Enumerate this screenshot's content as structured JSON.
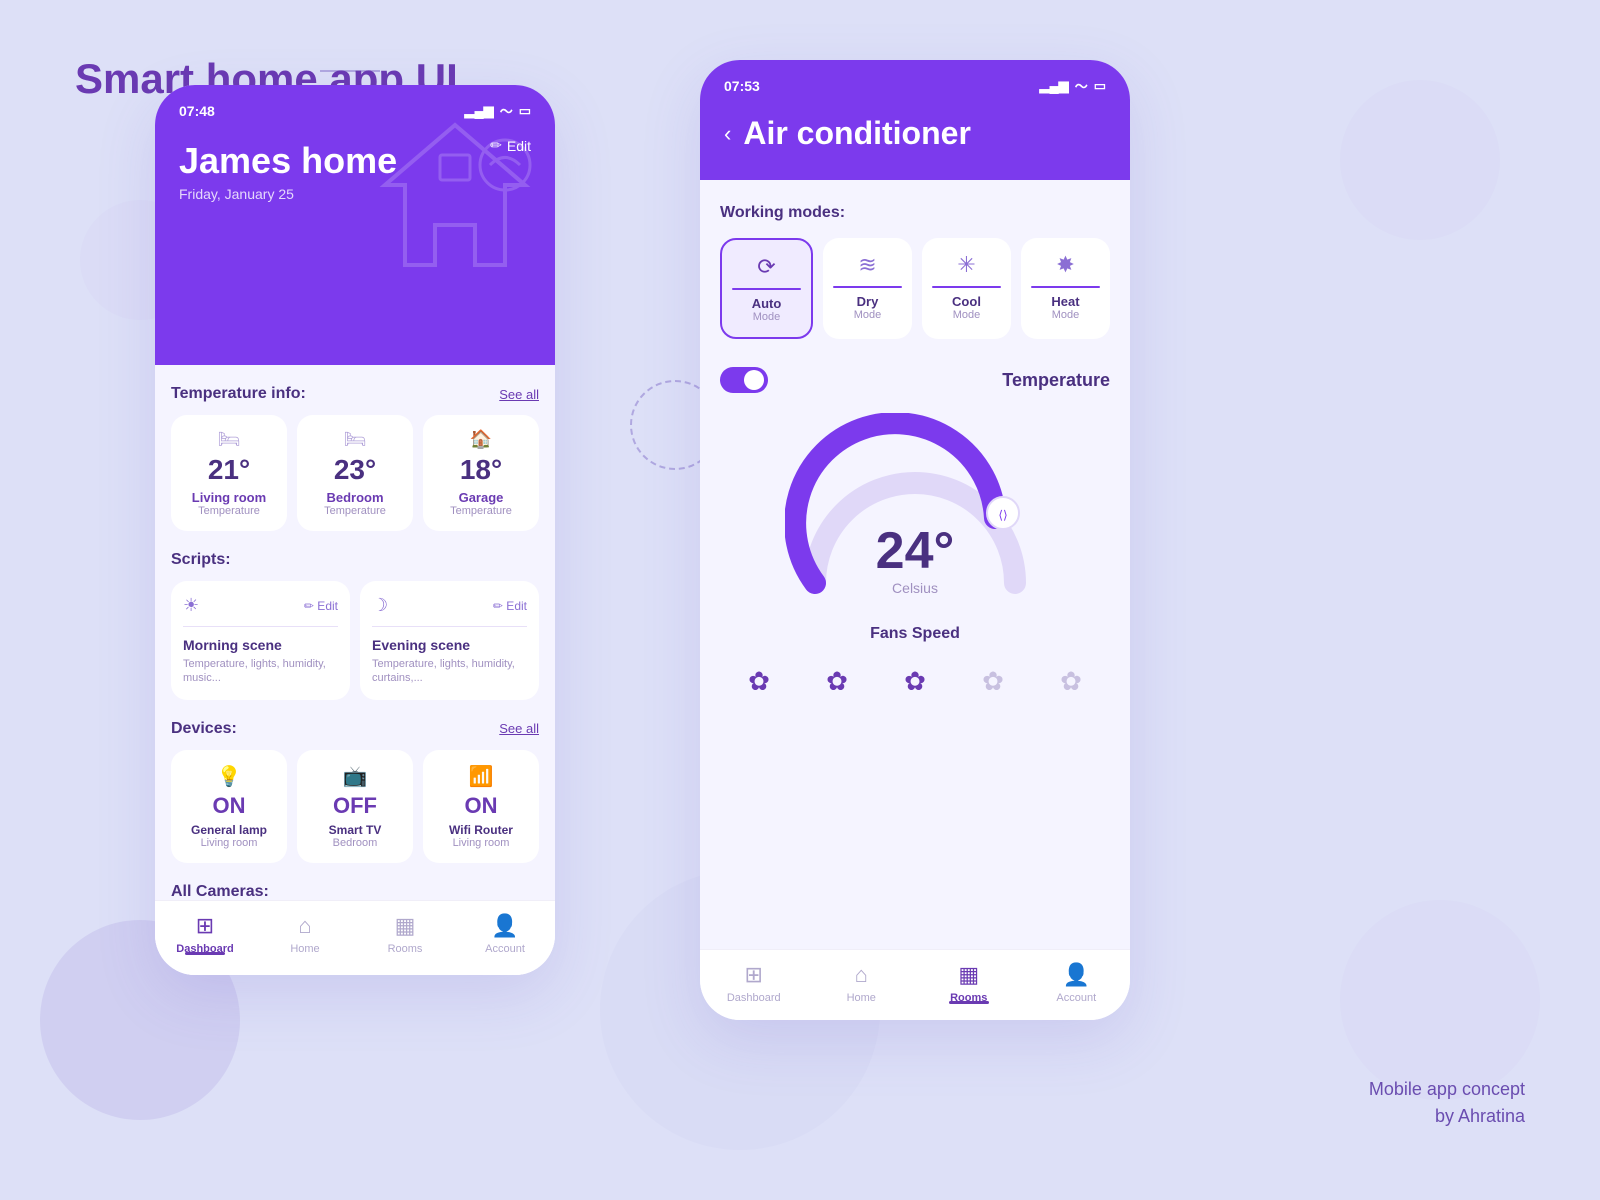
{
  "page": {
    "title": "Smart home app UI",
    "credit_line1": "Mobile app concept",
    "credit_line2": "by Ahratina",
    "bg_color": "#dde0f7"
  },
  "phone1": {
    "status_time": "07:48",
    "home_name": "James home",
    "home_date": "Friday, January 25",
    "edit_label": "Edit",
    "temperature_section": "Temperature info:",
    "see_all_temp": "See all",
    "temps": [
      {
        "value": "21°",
        "room": "Living room",
        "label": "Temperature"
      },
      {
        "value": "23°",
        "room": "Bedroom",
        "label": "Temperature"
      },
      {
        "value": "18°",
        "room": "Garage",
        "label": "Temperature"
      }
    ],
    "scripts_section": "Scripts:",
    "scripts": [
      {
        "icon": "☀",
        "edit": "✏ Edit",
        "name": "Morning scene",
        "desc": "Temperature, lights, humidity, music..."
      },
      {
        "icon": "☽",
        "edit": "✏ Edit",
        "name": "Evening scene",
        "desc": "Temperature, lights, humidity, curtains,..."
      }
    ],
    "devices_section": "Devices:",
    "see_all_devices": "See all",
    "devices": [
      {
        "icon": "💡",
        "status": "ON",
        "name": "General lamp",
        "location": "Living room"
      },
      {
        "icon": "📺",
        "status": "OFF",
        "name": "Smart TV",
        "location": "Bedroom"
      },
      {
        "icon": "📶",
        "status": "ON",
        "name": "Wifi Router",
        "location": "Living room"
      }
    ],
    "cameras_section": "All Cameras:",
    "nav": [
      {
        "icon": "⊞",
        "label": "Dashboard",
        "active": true
      },
      {
        "icon": "⌂",
        "label": "Home",
        "active": false
      },
      {
        "icon": "▦",
        "label": "Rooms",
        "active": false
      },
      {
        "icon": "👤",
        "label": "Account",
        "active": false
      }
    ]
  },
  "phone2": {
    "status_time": "07:53",
    "back_label": "‹",
    "title": "Air conditioner",
    "working_modes_title": "Working modes:",
    "modes": [
      {
        "icon": "⟳",
        "name": "Auto",
        "sub": "Mode",
        "active": true
      },
      {
        "icon": "≋",
        "name": "Dry",
        "sub": "Mode",
        "active": false
      },
      {
        "icon": "✳",
        "name": "Cool",
        "sub": "Mode",
        "active": false
      },
      {
        "icon": "✸",
        "name": "Heat",
        "sub": "Mode",
        "active": false
      }
    ],
    "temperature_label": "Temperature",
    "temp_value": "24°",
    "temp_unit": "Celsius",
    "fans_title": "Fans Speed",
    "fans": [
      {
        "active": true
      },
      {
        "active": true
      },
      {
        "active": true
      },
      {
        "active": false
      },
      {
        "active": false
      }
    ],
    "nav": [
      {
        "icon": "⊞",
        "label": "Dashboard",
        "active": false
      },
      {
        "icon": "⌂",
        "label": "Home",
        "active": false
      },
      {
        "icon": "▦",
        "label": "Rooms",
        "active": true
      },
      {
        "icon": "👤",
        "label": "Account",
        "active": false
      }
    ]
  }
}
